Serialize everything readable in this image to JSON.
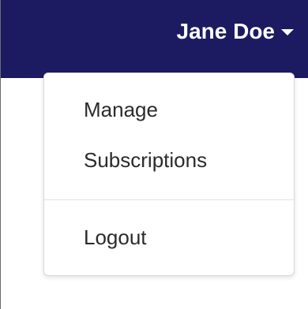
{
  "navbar": {
    "user_name": "Jane Doe",
    "background_color": "#1c1a60",
    "caret_icon": "caret-down-icon"
  },
  "dropdown": {
    "items": [
      {
        "label": "Manage"
      },
      {
        "label": "Subscriptions"
      },
      {
        "label": "Logout"
      }
    ]
  }
}
